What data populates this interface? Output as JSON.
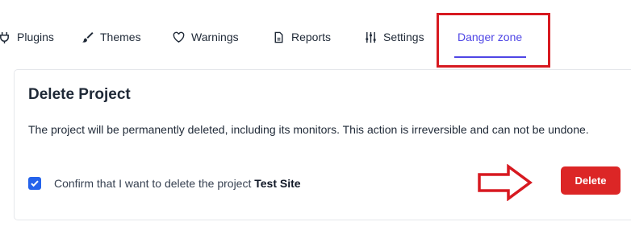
{
  "tabs": [
    {
      "label": "Plugins",
      "icon": "plug-icon"
    },
    {
      "label": "Themes",
      "icon": "brush-icon"
    },
    {
      "label": "Warnings",
      "icon": "heart-icon"
    },
    {
      "label": "Reports",
      "icon": "document-icon"
    },
    {
      "label": "Settings",
      "icon": "sliders-icon"
    },
    {
      "label": "Danger zone",
      "icon": "",
      "active": true
    }
  ],
  "card": {
    "title": "Delete Project",
    "description": "The project will be permanently deleted, including its monitors. This action is irreversible and can not be undone.",
    "confirm": {
      "checked": true,
      "text": "Confirm that I want to delete the project",
      "project_name": "Test Site"
    },
    "delete_label": "Delete"
  },
  "colors": {
    "accent": "#4f46e5",
    "danger": "#dc2626",
    "checkbox": "#2563eb",
    "annotation": "#d71920"
  }
}
